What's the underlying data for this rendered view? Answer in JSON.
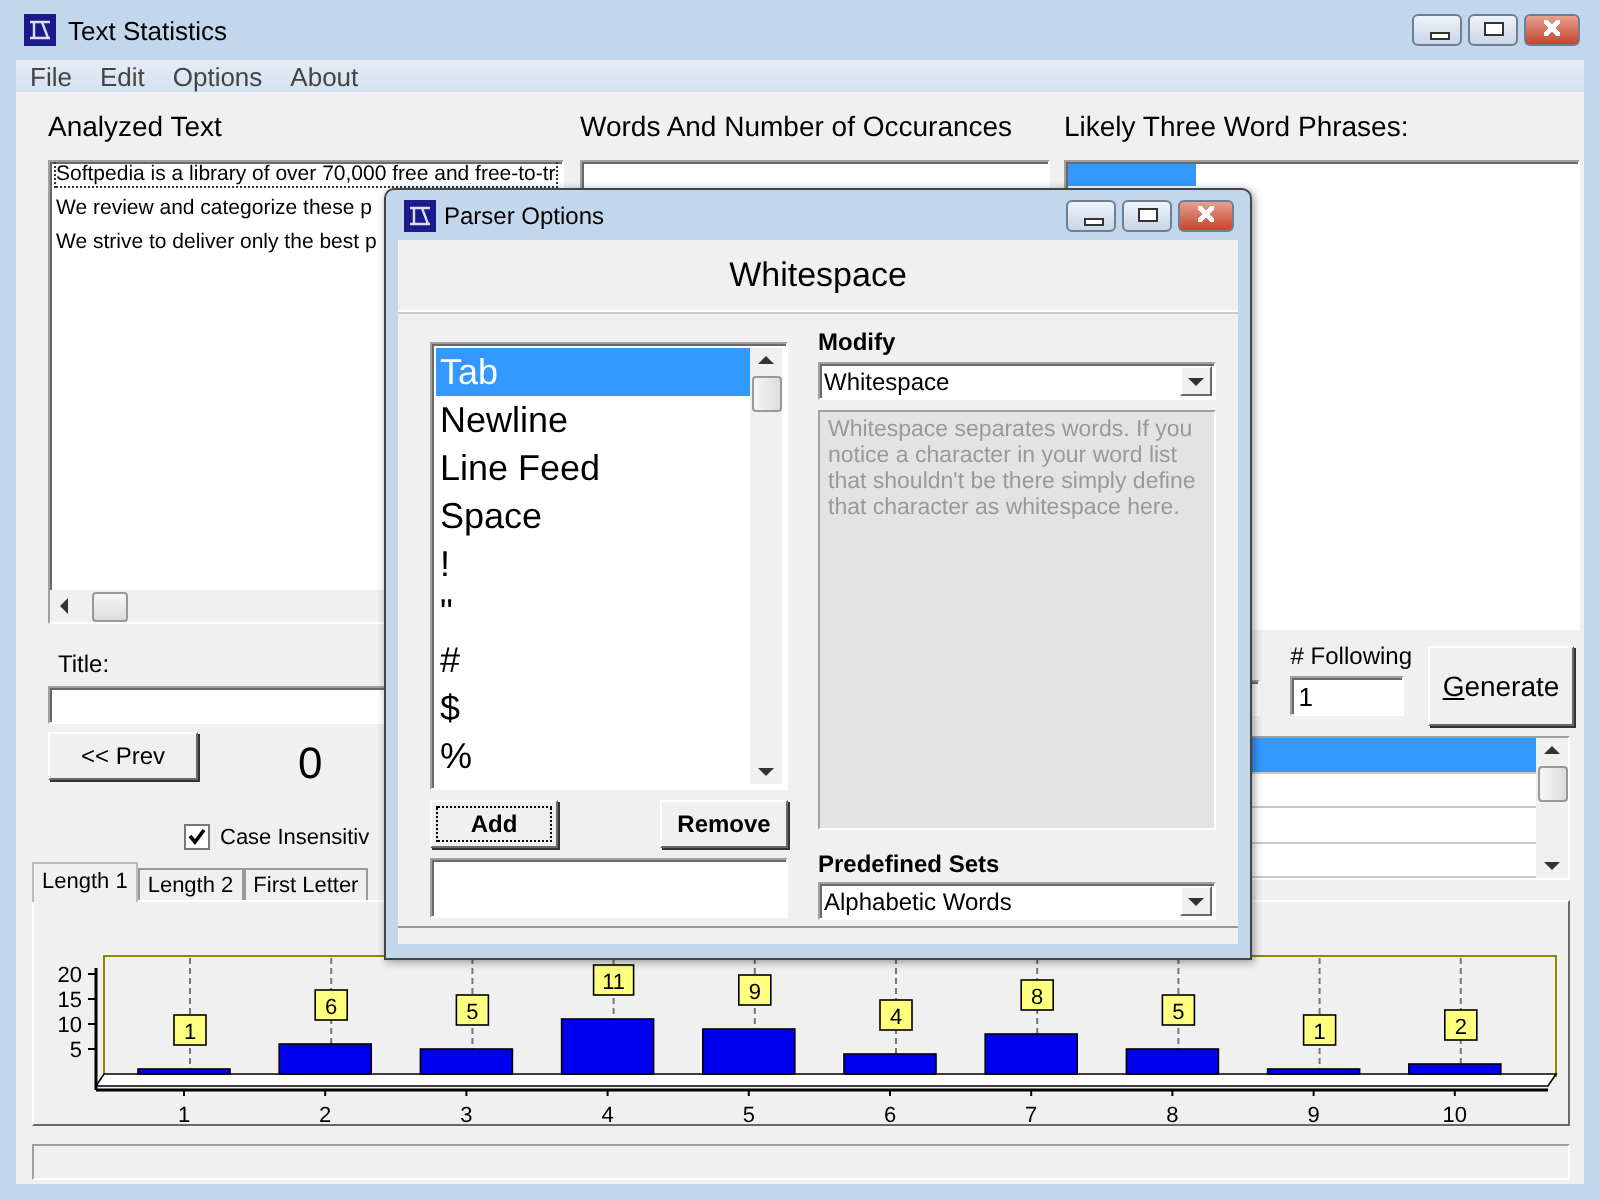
{
  "window": {
    "title": "Text Statistics"
  },
  "menu": [
    "File",
    "Edit",
    "Options",
    "About"
  ],
  "analyzed_text": {
    "label": "Analyzed Text",
    "lines": [
      "Softpedia is a library of over 70,000 free and free-to-tr",
      "We review and categorize these p",
      "We strive to deliver only the best p"
    ]
  },
  "words_panel": {
    "label": "Words And Number of Occurances"
  },
  "phrases_panel": {
    "label": "Likely Three Word Phrases:",
    "rows": [
      {
        "selected": true
      }
    ]
  },
  "title_field": {
    "label": "Title:"
  },
  "prev_button": "<< Prev",
  "counter": "0",
  "case_insensitive": {
    "label": "Case Insensitiv",
    "checked": true
  },
  "following": {
    "label": "# Following",
    "value": "1"
  },
  "generate_button": "Generate",
  "results_list": {
    "rows": [
      {
        "selected": true
      },
      {
        "selected": false
      },
      {
        "selected": false
      },
      {
        "selected": false
      }
    ]
  },
  "tabs": [
    {
      "label": "Length 1",
      "selected": true
    },
    {
      "label": "Length 2",
      "selected": false
    },
    {
      "label": "First Letter",
      "selected": false
    }
  ],
  "chart_data": {
    "type": "bar",
    "categories": [
      "1",
      "2",
      "3",
      "4",
      "5",
      "6",
      "7",
      "8",
      "9",
      "10"
    ],
    "values": [
      1,
      6,
      5,
      11,
      9,
      4,
      8,
      5,
      1,
      2
    ],
    "ylim": [
      0,
      20
    ],
    "yticks": [
      5,
      10,
      15,
      20
    ],
    "data_labels": true
  },
  "dialog": {
    "title": "Parser Options",
    "heading": "Whitespace",
    "items": [
      {
        "label": "Tab",
        "selected": true
      },
      {
        "label": "Newline",
        "selected": false
      },
      {
        "label": "Line Feed",
        "selected": false
      },
      {
        "label": "Space",
        "selected": false
      },
      {
        "label": "!",
        "selected": false
      },
      {
        "label": "\"",
        "selected": false
      },
      {
        "label": "#",
        "selected": false
      },
      {
        "label": "$",
        "selected": false
      },
      {
        "label": "%",
        "selected": false
      }
    ],
    "add_button": "Add",
    "remove_button": "Remove",
    "modify": {
      "label": "Modify",
      "value": "Whitespace",
      "description": "Whitespace separates words.  If you notice a character in your word list that shouldn't be there simply define that character as whitespace here."
    },
    "predefined_sets": {
      "label": "Predefined Sets",
      "value": "Alphabetic Words"
    }
  }
}
